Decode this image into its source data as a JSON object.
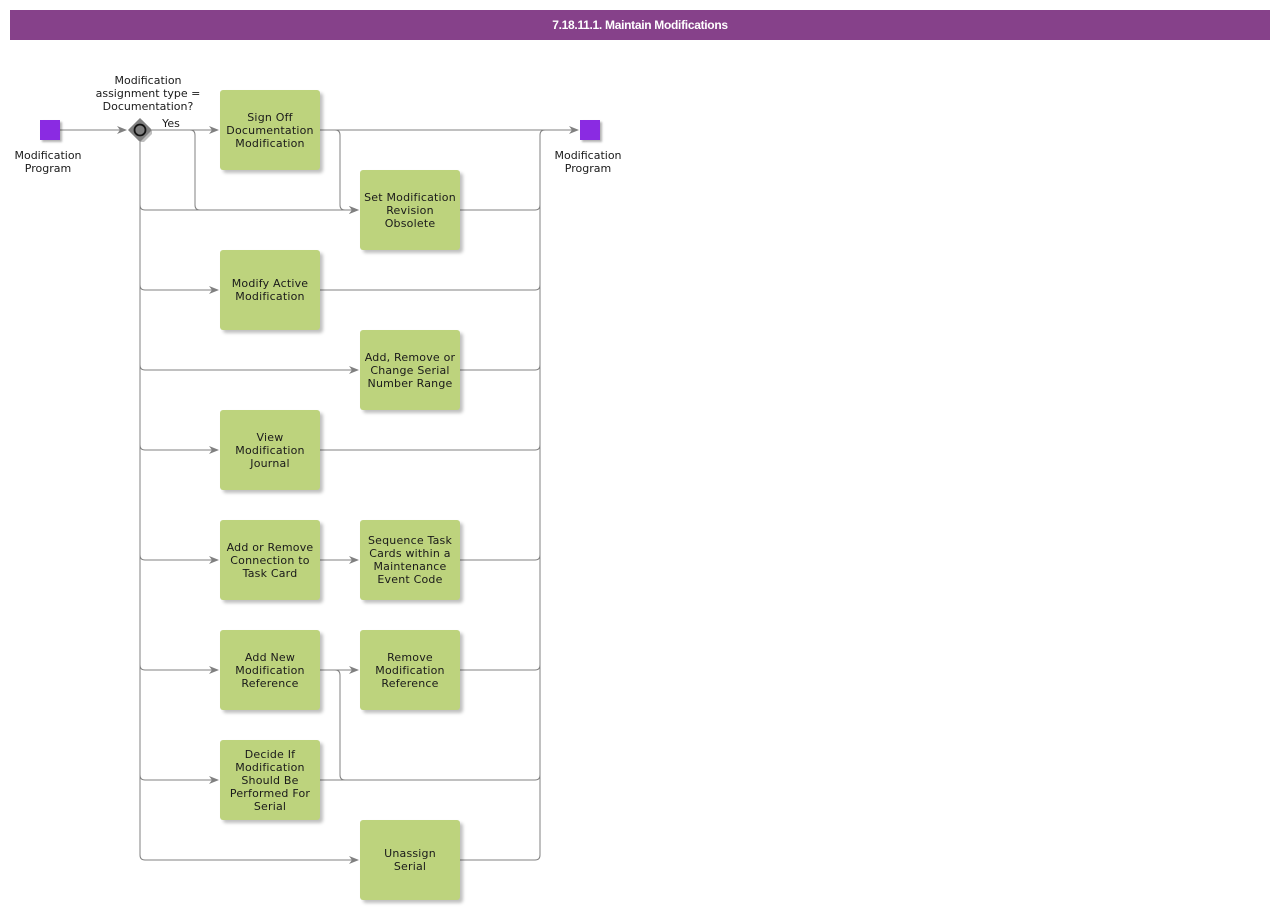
{
  "title": "7.18.11.1. Maintain Modifications",
  "colors": {
    "title_bar": "#86418a",
    "task_fill": "#bdd37d",
    "event_fill": "#8a2be2",
    "gateway_fill": "#808080",
    "edge": "#808080"
  },
  "start_event": {
    "label": "Modification\nProgram",
    "icon": "start-event-square"
  },
  "end_event": {
    "label": "Modification\nProgram",
    "icon": "end-event-square"
  },
  "gateway": {
    "question": "Modification\nassignment type =\nDocumentation?",
    "yes_label": "Yes",
    "icon": "exclusive-gateway-diamond"
  },
  "tasks": [
    {
      "id": "sign-off",
      "label": "Sign Off\nDocumentation\nModification"
    },
    {
      "id": "set-obsolete",
      "label": "Set Modification\nRevision\nObsolete"
    },
    {
      "id": "modify-active",
      "label": "Modify Active\nModification"
    },
    {
      "id": "serial-range",
      "label": "Add, Remove or\nChange Serial\nNumber Range"
    },
    {
      "id": "view-journal",
      "label": "View\nModification\nJournal"
    },
    {
      "id": "task-card-connection",
      "label": "Add or Remove\nConnection to\nTask Card"
    },
    {
      "id": "sequence-task-cards",
      "label": "Sequence Task\nCards within a\nMaintenance\nEvent Code"
    },
    {
      "id": "add-reference",
      "label": "Add New\nModification\nReference"
    },
    {
      "id": "remove-reference",
      "label": "Remove\nModification\nReference"
    },
    {
      "id": "decide-serial",
      "label": "Decide If\nModification\nShould Be\nPerformed For\nSerial"
    },
    {
      "id": "unassign-serial",
      "label": "Unassign\nSerial"
    }
  ]
}
